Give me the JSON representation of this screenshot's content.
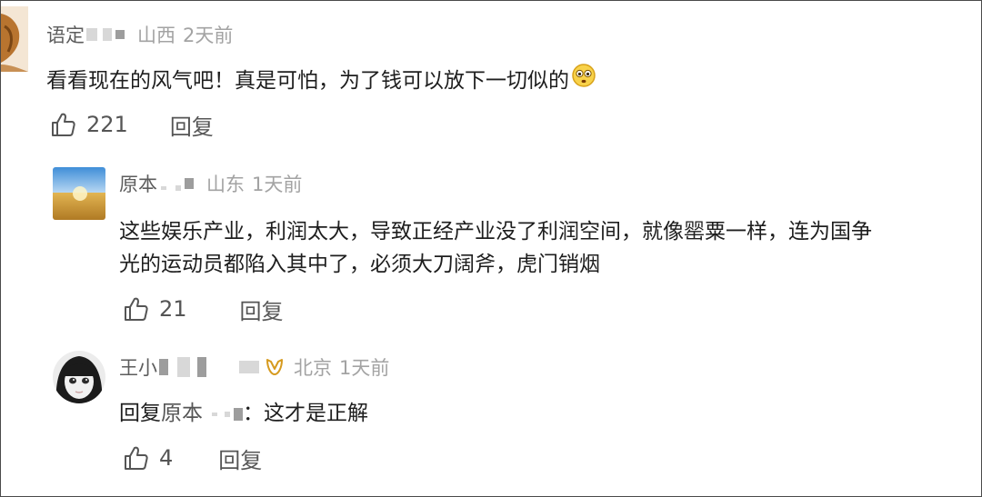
{
  "comments": [
    {
      "name_prefix": "语定",
      "location": "山西",
      "time": "2天前",
      "text": "看看现在的风气吧！真是可怕，为了钱可以放下一切似的",
      "emoji_icon": "worried-face-emoji",
      "likes": "221",
      "reply_label": "回复"
    },
    {
      "name_prefix": "原本",
      "location": "山东",
      "time": "1天前",
      "text_line1": "这些娱乐产业，利润太大，导致正经产业没了利润空间，就像罂粟一样，连为国争",
      "text_line2": "光的运动员都陷入其中了，必须大刀阔斧，虎门销烟",
      "likes": "21",
      "reply_label": "回复"
    },
    {
      "name_prefix": "王小",
      "location": "北京",
      "time": "1天前",
      "reply_prefix": "回复",
      "reply_to": "原本",
      "text": "这才是正解",
      "likes": "4",
      "reply_label": "回复"
    }
  ]
}
